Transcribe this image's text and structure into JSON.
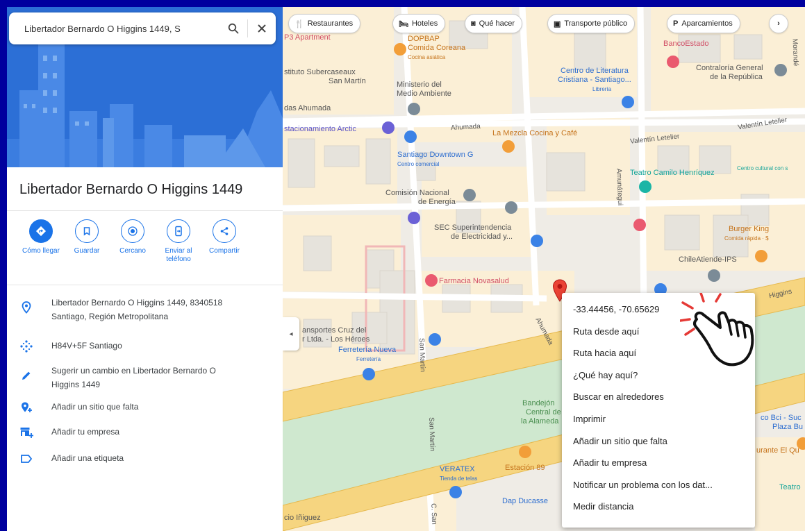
{
  "search": {
    "value": "Libertador Bernardo O Higgins 1449, S"
  },
  "place": {
    "title": "Libertador Bernardo O Higgins 1449",
    "actions": [
      {
        "label": "Cómo llegar",
        "icon": "directions-icon"
      },
      {
        "label": "Guardar",
        "icon": "bookmark-icon"
      },
      {
        "label": "Cercano",
        "icon": "nearby-icon"
      },
      {
        "label": "Enviar al teléfono",
        "icon": "send-to-phone-icon"
      },
      {
        "label": "Compartir",
        "icon": "share-icon"
      }
    ],
    "info": [
      {
        "icon": "location-pin-icon",
        "line1": "Libertador Bernardo O Higgins 1449, 8340518",
        "line2": "Santiago, Región Metropolitana"
      },
      {
        "icon": "plus-code-icon",
        "line1": "H84V+5F Santiago",
        "line2": ""
      },
      {
        "icon": "pencil-icon",
        "line1": "Sugerir un cambio en Libertador Bernardo O",
        "line2": "Higgins 1449"
      },
      {
        "icon": "add-place-icon",
        "line1": "Añadir un sitio que falta",
        "line2": ""
      },
      {
        "icon": "add-business-icon",
        "line1": "Añadir tu empresa",
        "line2": ""
      },
      {
        "icon": "label-icon",
        "line1": "Añadir una etiqueta",
        "line2": ""
      }
    ]
  },
  "chips": [
    {
      "icon": "restaurant-icon",
      "glyph": "🍴",
      "label": "Restaurantes"
    },
    {
      "icon": "hotel-icon",
      "glyph": "🛏",
      "label": "Hoteles"
    },
    {
      "icon": "things-to-do-icon",
      "glyph": "◙",
      "label": "Qué hacer"
    },
    {
      "icon": "transit-icon",
      "glyph": "▣",
      "label": "Transporte público"
    },
    {
      "icon": "parking-icon",
      "glyph": "P",
      "label": "Aparcamientos"
    }
  ],
  "map_labels": [
    {
      "name": "label-dopbap",
      "text": "DOPBAP",
      "sub": "",
      "color": "#c5731b"
    },
    {
      "name": "label-comida-coreana",
      "text": "Comida Coreana",
      "sub": "Cocina asiática",
      "color": "#c5731b"
    },
    {
      "name": "label-p3-apartment",
      "text": "P3 Apartment",
      "sub": "",
      "color": "#d14f66"
    },
    {
      "name": "label-instituto",
      "text": "stituto Subercaseaux",
      "sub": "",
      "color": "#555"
    },
    {
      "name": "label-san-martin",
      "text": "San Martín",
      "sub": "",
      "color": "#555"
    },
    {
      "name": "label-ministerio",
      "text": "Ministerio del",
      "sub": "",
      "color": "#555"
    },
    {
      "name": "label-medio-ambiente",
      "text": "Medio Ambiente",
      "sub": "",
      "color": "#555"
    },
    {
      "name": "label-das-ahumada",
      "text": "das Ahumada",
      "sub": "",
      "color": "#555"
    },
    {
      "name": "label-estacionamiento",
      "text": "stacionamiento Arctic",
      "sub": "",
      "color": "#5a52c7"
    },
    {
      "name": "label-centro-literatura",
      "text": "Centro de Literatura",
      "sub": "",
      "color": "#2f6fd0"
    },
    {
      "name": "label-cristiana",
      "text": "Cristiana - Santiago...",
      "sub": "Librería",
      "color": "#2f6fd0"
    },
    {
      "name": "label-contraloria",
      "text": "Contraloría General",
      "sub": "",
      "color": "#555"
    },
    {
      "name": "label-republica",
      "text": "de la República",
      "sub": "",
      "color": "#555"
    },
    {
      "name": "label-bancoestado",
      "text": "BancoEstado",
      "sub": "",
      "color": "#d14f66"
    },
    {
      "name": "label-la-mezcla",
      "text": "La Mezcla Cocina y Café",
      "sub": "",
      "color": "#c5731b"
    },
    {
      "name": "label-santiago-downtown",
      "text": "Santiago Downtown G",
      "sub": "Centro comercial",
      "color": "#2f6fd0"
    },
    {
      "name": "label-teatro-camilo",
      "text": "Teatro Camilo Henríquez",
      "sub": "",
      "color": "#16a59a"
    },
    {
      "name": "label-centro-cultural",
      "text": "Centro cultural con s",
      "sub": "",
      "color": "#16a59a"
    },
    {
      "name": "label-comision",
      "text": "Comisión Nacional",
      "sub": "",
      "color": "#555"
    },
    {
      "name": "label-energia",
      "text": "de Energía",
      "sub": "",
      "color": "#555"
    },
    {
      "name": "label-sec",
      "text": "SEC Superintendencia",
      "sub": "",
      "color": "#555"
    },
    {
      "name": "label-electricidad",
      "text": "de Electricidad y...",
      "sub": "",
      "color": "#555"
    },
    {
      "name": "label-burger-king",
      "text": "Burger King",
      "sub": "Comida rápida · $",
      "color": "#c5731b"
    },
    {
      "name": "label-chileatiende",
      "text": "ChileAtiende-IPS",
      "sub": "",
      "color": "#555"
    },
    {
      "name": "label-farmacia",
      "text": "Farmacia Novasalud",
      "sub": "",
      "color": "#d14f66"
    },
    {
      "name": "label-transportes",
      "text": "ansportes Cruz del",
      "sub": "",
      "color": "#555"
    },
    {
      "name": "label-sur-ltda",
      "text": "r Ltda. - Los Héroes",
      "sub": "",
      "color": "#555"
    },
    {
      "name": "label-ferreteria",
      "text": "Ferretería Nueva",
      "sub": "Ferretería",
      "color": "#2f6fd0"
    },
    {
      "name": "label-bandejon",
      "text": "Bandejón",
      "sub": "",
      "color": "#4a8f50"
    },
    {
      "name": "label-central-de",
      "text": "Central de",
      "sub": "",
      "color": "#4a8f50"
    },
    {
      "name": "label-la-alameda",
      "text": "la Alameda",
      "sub": "",
      "color": "#4a8f50"
    },
    {
      "name": "label-veratex",
      "text": "VERATEX",
      "sub": "Tienda de telas",
      "color": "#2f6fd0"
    },
    {
      "name": "label-estacion-89",
      "text": "Estación 89",
      "sub": "",
      "color": "#c5731b"
    },
    {
      "name": "label-dap-ducasse",
      "text": "Dap Ducasse",
      "sub": "",
      "color": "#2f6fd0"
    },
    {
      "name": "label-co-bci",
      "text": "co Bci - Suc",
      "sub": "",
      "color": "#2f6fd0"
    },
    {
      "name": "label-plaza-bu",
      "text": "Plaza Bu",
      "sub": "",
      "color": "#2f6fd0"
    },
    {
      "name": "label-urante-el-qu",
      "text": "urante El Qu",
      "sub": "",
      "color": "#c5731b"
    },
    {
      "name": "label-teatro",
      "text": "Teatro",
      "sub": "",
      "color": "#16a59a"
    },
    {
      "name": "label-cio-iniguez",
      "text": "cio Iñiguez",
      "sub": "",
      "color": "#555"
    }
  ],
  "street_labels": [
    {
      "name": "street-ahumada-top",
      "text": "Ahumada"
    },
    {
      "name": "street-valentin-1",
      "text": "Valentín Letelier"
    },
    {
      "name": "street-valentin-2",
      "text": "Valentín Letelier"
    },
    {
      "name": "street-amunategui",
      "text": "Amunátegui"
    },
    {
      "name": "street-san-martin-1",
      "text": "San Martín"
    },
    {
      "name": "street-san-martin-2",
      "text": "San Martín"
    },
    {
      "name": "street-c-san",
      "text": "C. San"
    },
    {
      "name": "street-ahumada-bottom",
      "text": "Ahumada"
    },
    {
      "name": "street-higgins",
      "text": "Higgins"
    },
    {
      "name": "street-morande",
      "text": "Morandé"
    }
  ],
  "context_menu": [
    "-33.44456, -70.65629",
    "Ruta desde aquí",
    "Ruta hacia aquí",
    "¿Qué hay aquí?",
    "Buscar en alrededores",
    "Imprimir",
    "Añadir un sitio que falta",
    "Añadir tu empresa",
    "Notificar un problema con los dat...",
    "Medir distancia"
  ],
  "colors": {
    "frame": "#00009e",
    "accent": "#1a73e8",
    "hero": "#2c6fd6",
    "pin": "#ea4335",
    "main_road": "#f6d580",
    "park": "#cfe8cf"
  }
}
